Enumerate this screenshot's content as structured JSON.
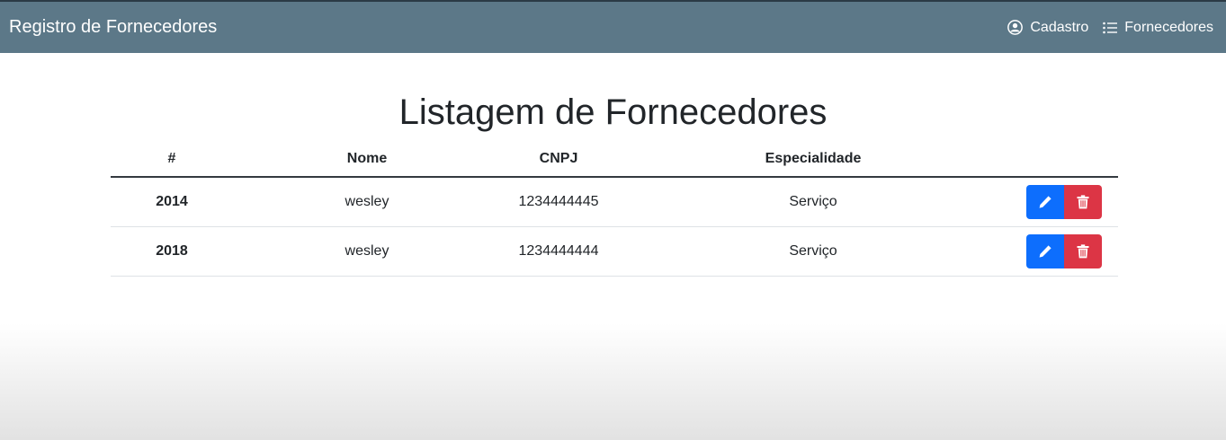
{
  "navbar": {
    "brand": "Registro de Fornecedores",
    "links": [
      {
        "label": "Cadastro",
        "icon": "user-circle-icon"
      },
      {
        "label": "Fornecedores",
        "icon": "list-icon"
      }
    ]
  },
  "page": {
    "title": "Listagem de Fornecedores"
  },
  "table": {
    "headers": [
      "#",
      "Nome",
      "CNPJ",
      "Especialidade",
      ""
    ],
    "rows": [
      {
        "id": "2014",
        "nome": "wesley",
        "cnpj": "1234444445",
        "especialidade": "Serviço"
      },
      {
        "id": "2018",
        "nome": "wesley",
        "cnpj": "1234444444",
        "especialidade": "Serviço"
      }
    ]
  },
  "colors": {
    "navbar": "#5c7888",
    "edit_button": "#0d6efd",
    "delete_button": "#dc3545"
  },
  "icons": {
    "edit": "pencil-icon",
    "delete": "trash-icon"
  }
}
